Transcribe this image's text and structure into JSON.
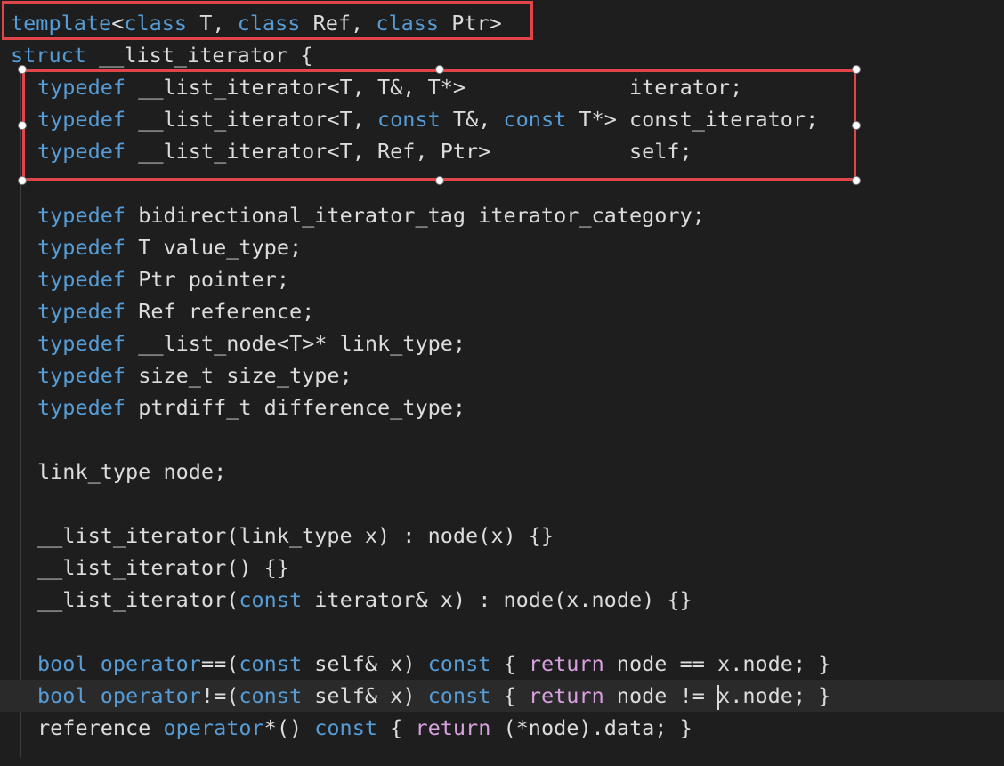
{
  "editor": {
    "lines": [
      {
        "indent": 0,
        "tokens": [
          {
            "t": "template",
            "c": "kw"
          },
          {
            "t": "<",
            "c": "pl"
          },
          {
            "t": "class",
            "c": "kw"
          },
          {
            "t": " T, ",
            "c": "pl"
          },
          {
            "t": "class",
            "c": "kw"
          },
          {
            "t": " Ref, ",
            "c": "pl"
          },
          {
            "t": "class",
            "c": "kw"
          },
          {
            "t": " Ptr>",
            "c": "pl"
          }
        ]
      },
      {
        "indent": 0,
        "tokens": [
          {
            "t": "struct",
            "c": "kw"
          },
          {
            "t": " __list_iterator {",
            "c": "pl"
          }
        ]
      },
      {
        "indent": 1,
        "tokens": [
          {
            "t": "typedef",
            "c": "kw"
          },
          {
            "t": " __list_iterator<T, T&, T*>",
            "c": "pl"
          },
          {
            "t": "             iterator;",
            "c": "pl"
          }
        ]
      },
      {
        "indent": 1,
        "tokens": [
          {
            "t": "typedef",
            "c": "kw"
          },
          {
            "t": " __list_iterator<T, ",
            "c": "pl"
          },
          {
            "t": "const",
            "c": "kw"
          },
          {
            "t": " T&, ",
            "c": "pl"
          },
          {
            "t": "const",
            "c": "kw"
          },
          {
            "t": " T*> const_iterator;",
            "c": "pl"
          }
        ]
      },
      {
        "indent": 1,
        "tokens": [
          {
            "t": "typedef",
            "c": "kw"
          },
          {
            "t": " __list_iterator<T, Ref, Ptr>",
            "c": "pl"
          },
          {
            "t": "           self;",
            "c": "pl"
          }
        ]
      },
      {
        "indent": 1,
        "tokens": []
      },
      {
        "indent": 1,
        "tokens": [
          {
            "t": "typedef",
            "c": "kw"
          },
          {
            "t": " bidirectional_iterator_tag iterator_category;",
            "c": "pl"
          }
        ]
      },
      {
        "indent": 1,
        "tokens": [
          {
            "t": "typedef",
            "c": "kw"
          },
          {
            "t": " T value_type;",
            "c": "pl"
          }
        ]
      },
      {
        "indent": 1,
        "tokens": [
          {
            "t": "typedef",
            "c": "kw"
          },
          {
            "t": " Ptr pointer;",
            "c": "pl"
          }
        ]
      },
      {
        "indent": 1,
        "tokens": [
          {
            "t": "typedef",
            "c": "kw"
          },
          {
            "t": " Ref reference;",
            "c": "pl"
          }
        ]
      },
      {
        "indent": 1,
        "tokens": [
          {
            "t": "typedef",
            "c": "kw"
          },
          {
            "t": " __list_node<T>* link_type;",
            "c": "pl"
          }
        ]
      },
      {
        "indent": 1,
        "tokens": [
          {
            "t": "typedef",
            "c": "kw"
          },
          {
            "t": " size_t size_type;",
            "c": "pl"
          }
        ]
      },
      {
        "indent": 1,
        "tokens": [
          {
            "t": "typedef",
            "c": "kw"
          },
          {
            "t": " ptrdiff_t difference_type;",
            "c": "pl"
          }
        ]
      },
      {
        "indent": 1,
        "tokens": []
      },
      {
        "indent": 1,
        "tokens": [
          {
            "t": "link_type node;",
            "c": "pl"
          }
        ]
      },
      {
        "indent": 1,
        "tokens": []
      },
      {
        "indent": 1,
        "tokens": [
          {
            "t": "__list_iterator(link_type x) : node(x) {}",
            "c": "pl"
          }
        ]
      },
      {
        "indent": 1,
        "tokens": [
          {
            "t": "__list_iterator() {}",
            "c": "pl"
          }
        ]
      },
      {
        "indent": 1,
        "tokens": [
          {
            "t": "__list_iterator(",
            "c": "pl"
          },
          {
            "t": "const",
            "c": "kw"
          },
          {
            "t": " iterator& x) : node(x.node) {}",
            "c": "pl"
          }
        ]
      },
      {
        "indent": 1,
        "tokens": []
      },
      {
        "indent": 1,
        "tokens": [
          {
            "t": "bool",
            "c": "kw"
          },
          {
            "t": " ",
            "c": "pl"
          },
          {
            "t": "operator",
            "c": "kw"
          },
          {
            "t": "==(",
            "c": "pl"
          },
          {
            "t": "const",
            "c": "kw"
          },
          {
            "t": " self& x) ",
            "c": "pl"
          },
          {
            "t": "const",
            "c": "kw"
          },
          {
            "t": " { ",
            "c": "pl"
          },
          {
            "t": "return",
            "c": "ctl"
          },
          {
            "t": " node == x.node; }",
            "c": "pl"
          }
        ]
      },
      {
        "indent": 1,
        "current": true,
        "tokens": [
          {
            "t": "bool",
            "c": "kw"
          },
          {
            "t": " ",
            "c": "pl"
          },
          {
            "t": "operator",
            "c": "kw"
          },
          {
            "t": "!=(",
            "c": "pl"
          },
          {
            "t": "const",
            "c": "kw"
          },
          {
            "t": " self& x) ",
            "c": "pl"
          },
          {
            "t": "const",
            "c": "kw"
          },
          {
            "t": " { ",
            "c": "pl"
          },
          {
            "t": "return",
            "c": "ctl"
          },
          {
            "t": " node != ",
            "c": "pl"
          },
          {
            "caret": true
          },
          {
            "t": "x.node; }",
            "c": "pl"
          }
        ]
      },
      {
        "indent": 1,
        "tokens": [
          {
            "t": "reference ",
            "c": "pl"
          },
          {
            "t": "operator",
            "c": "kw"
          },
          {
            "t": "*() ",
            "c": "pl"
          },
          {
            "t": "const",
            "c": "kw"
          },
          {
            "t": " { ",
            "c": "pl"
          },
          {
            "t": "return",
            "c": "ctl"
          },
          {
            "t": " (*node).data; }",
            "c": "pl"
          }
        ]
      }
    ]
  },
  "highlight_boxes": [
    {
      "name": "template-line-highlight",
      "from_line": 0,
      "to_line": 0,
      "has_handles": false
    },
    {
      "name": "typedef-block-highlight",
      "from_line": 2,
      "to_line": 4,
      "has_handles": true
    }
  ],
  "colors": {
    "background": "#1e1e1e",
    "keyword": "#569cd6",
    "control_keyword": "#d8a0df",
    "plain_text": "#dcdcdc",
    "highlight_border": "#e0454a",
    "current_line": "#2a2a2a"
  }
}
